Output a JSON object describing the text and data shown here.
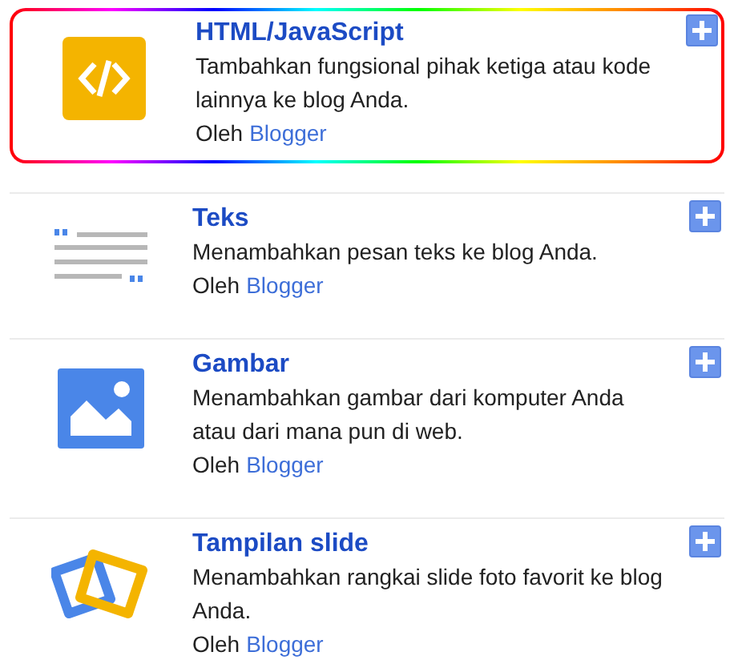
{
  "gadgets": [
    {
      "kind": "code",
      "title": "HTML/JavaScript",
      "description": "Tambahkan fungsional pihak ketiga atau kode lainnya ke blog Anda.",
      "by": "Oleh",
      "author": "Blogger",
      "selected": true
    },
    {
      "kind": "text",
      "title": "Teks",
      "description": "Menambahkan pesan teks ke blog Anda.",
      "by": "Oleh",
      "author": "Blogger",
      "selected": false
    },
    {
      "kind": "image",
      "title": "Gambar",
      "description": "Menambahkan gambar dari komputer Anda atau dari mana pun di web.",
      "by": "Oleh",
      "author": "Blogger",
      "selected": false
    },
    {
      "kind": "slides",
      "title": "Tampilan slide",
      "description": "Menambahkan rangkai slide foto favorit ke blog Anda.",
      "by": "Oleh",
      "author": "Blogger",
      "selected": false
    }
  ]
}
